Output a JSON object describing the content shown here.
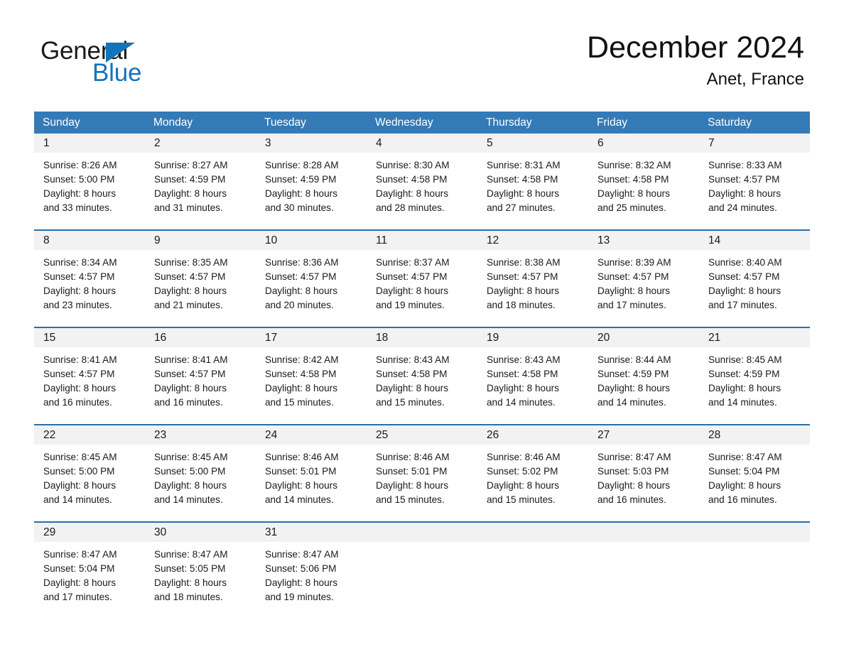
{
  "logo": {
    "word_one": "General",
    "word_two": "Blue",
    "flag_icon": "triangle-flag-icon",
    "accent_color": "#1373bc"
  },
  "header": {
    "title": "December 2024",
    "location": "Anet, France"
  },
  "theme": {
    "header_bg": "#337ab7",
    "row_border": "#2e6da4",
    "date_band_bg": "#f2f2f2",
    "text": "#1a1a1a"
  },
  "weekdays": [
    "Sunday",
    "Monday",
    "Tuesday",
    "Wednesday",
    "Thursday",
    "Friday",
    "Saturday"
  ],
  "weeks": [
    [
      {
        "date": "1",
        "sunrise": "Sunrise: 8:26 AM",
        "sunset": "Sunset: 5:00 PM",
        "daylight_line1": "Daylight: 8 hours",
        "daylight_line2": "and 33 minutes."
      },
      {
        "date": "2",
        "sunrise": "Sunrise: 8:27 AM",
        "sunset": "Sunset: 4:59 PM",
        "daylight_line1": "Daylight: 8 hours",
        "daylight_line2": "and 31 minutes."
      },
      {
        "date": "3",
        "sunrise": "Sunrise: 8:28 AM",
        "sunset": "Sunset: 4:59 PM",
        "daylight_line1": "Daylight: 8 hours",
        "daylight_line2": "and 30 minutes."
      },
      {
        "date": "4",
        "sunrise": "Sunrise: 8:30 AM",
        "sunset": "Sunset: 4:58 PM",
        "daylight_line1": "Daylight: 8 hours",
        "daylight_line2": "and 28 minutes."
      },
      {
        "date": "5",
        "sunrise": "Sunrise: 8:31 AM",
        "sunset": "Sunset: 4:58 PM",
        "daylight_line1": "Daylight: 8 hours",
        "daylight_line2": "and 27 minutes."
      },
      {
        "date": "6",
        "sunrise": "Sunrise: 8:32 AM",
        "sunset": "Sunset: 4:58 PM",
        "daylight_line1": "Daylight: 8 hours",
        "daylight_line2": "and 25 minutes."
      },
      {
        "date": "7",
        "sunrise": "Sunrise: 8:33 AM",
        "sunset": "Sunset: 4:57 PM",
        "daylight_line1": "Daylight: 8 hours",
        "daylight_line2": "and 24 minutes."
      }
    ],
    [
      {
        "date": "8",
        "sunrise": "Sunrise: 8:34 AM",
        "sunset": "Sunset: 4:57 PM",
        "daylight_line1": "Daylight: 8 hours",
        "daylight_line2": "and 23 minutes."
      },
      {
        "date": "9",
        "sunrise": "Sunrise: 8:35 AM",
        "sunset": "Sunset: 4:57 PM",
        "daylight_line1": "Daylight: 8 hours",
        "daylight_line2": "and 21 minutes."
      },
      {
        "date": "10",
        "sunrise": "Sunrise: 8:36 AM",
        "sunset": "Sunset: 4:57 PM",
        "daylight_line1": "Daylight: 8 hours",
        "daylight_line2": "and 20 minutes."
      },
      {
        "date": "11",
        "sunrise": "Sunrise: 8:37 AM",
        "sunset": "Sunset: 4:57 PM",
        "daylight_line1": "Daylight: 8 hours",
        "daylight_line2": "and 19 minutes."
      },
      {
        "date": "12",
        "sunrise": "Sunrise: 8:38 AM",
        "sunset": "Sunset: 4:57 PM",
        "daylight_line1": "Daylight: 8 hours",
        "daylight_line2": "and 18 minutes."
      },
      {
        "date": "13",
        "sunrise": "Sunrise: 8:39 AM",
        "sunset": "Sunset: 4:57 PM",
        "daylight_line1": "Daylight: 8 hours",
        "daylight_line2": "and 17 minutes."
      },
      {
        "date": "14",
        "sunrise": "Sunrise: 8:40 AM",
        "sunset": "Sunset: 4:57 PM",
        "daylight_line1": "Daylight: 8 hours",
        "daylight_line2": "and 17 minutes."
      }
    ],
    [
      {
        "date": "15",
        "sunrise": "Sunrise: 8:41 AM",
        "sunset": "Sunset: 4:57 PM",
        "daylight_line1": "Daylight: 8 hours",
        "daylight_line2": "and 16 minutes."
      },
      {
        "date": "16",
        "sunrise": "Sunrise: 8:41 AM",
        "sunset": "Sunset: 4:57 PM",
        "daylight_line1": "Daylight: 8 hours",
        "daylight_line2": "and 16 minutes."
      },
      {
        "date": "17",
        "sunrise": "Sunrise: 8:42 AM",
        "sunset": "Sunset: 4:58 PM",
        "daylight_line1": "Daylight: 8 hours",
        "daylight_line2": "and 15 minutes."
      },
      {
        "date": "18",
        "sunrise": "Sunrise: 8:43 AM",
        "sunset": "Sunset: 4:58 PM",
        "daylight_line1": "Daylight: 8 hours",
        "daylight_line2": "and 15 minutes."
      },
      {
        "date": "19",
        "sunrise": "Sunrise: 8:43 AM",
        "sunset": "Sunset: 4:58 PM",
        "daylight_line1": "Daylight: 8 hours",
        "daylight_line2": "and 14 minutes."
      },
      {
        "date": "20",
        "sunrise": "Sunrise: 8:44 AM",
        "sunset": "Sunset: 4:59 PM",
        "daylight_line1": "Daylight: 8 hours",
        "daylight_line2": "and 14 minutes."
      },
      {
        "date": "21",
        "sunrise": "Sunrise: 8:45 AM",
        "sunset": "Sunset: 4:59 PM",
        "daylight_line1": "Daylight: 8 hours",
        "daylight_line2": "and 14 minutes."
      }
    ],
    [
      {
        "date": "22",
        "sunrise": "Sunrise: 8:45 AM",
        "sunset": "Sunset: 5:00 PM",
        "daylight_line1": "Daylight: 8 hours",
        "daylight_line2": "and 14 minutes."
      },
      {
        "date": "23",
        "sunrise": "Sunrise: 8:45 AM",
        "sunset": "Sunset: 5:00 PM",
        "daylight_line1": "Daylight: 8 hours",
        "daylight_line2": "and 14 minutes."
      },
      {
        "date": "24",
        "sunrise": "Sunrise: 8:46 AM",
        "sunset": "Sunset: 5:01 PM",
        "daylight_line1": "Daylight: 8 hours",
        "daylight_line2": "and 14 minutes."
      },
      {
        "date": "25",
        "sunrise": "Sunrise: 8:46 AM",
        "sunset": "Sunset: 5:01 PM",
        "daylight_line1": "Daylight: 8 hours",
        "daylight_line2": "and 15 minutes."
      },
      {
        "date": "26",
        "sunrise": "Sunrise: 8:46 AM",
        "sunset": "Sunset: 5:02 PM",
        "daylight_line1": "Daylight: 8 hours",
        "daylight_line2": "and 15 minutes."
      },
      {
        "date": "27",
        "sunrise": "Sunrise: 8:47 AM",
        "sunset": "Sunset: 5:03 PM",
        "daylight_line1": "Daylight: 8 hours",
        "daylight_line2": "and 16 minutes."
      },
      {
        "date": "28",
        "sunrise": "Sunrise: 8:47 AM",
        "sunset": "Sunset: 5:04 PM",
        "daylight_line1": "Daylight: 8 hours",
        "daylight_line2": "and 16 minutes."
      }
    ],
    [
      {
        "date": "29",
        "sunrise": "Sunrise: 8:47 AM",
        "sunset": "Sunset: 5:04 PM",
        "daylight_line1": "Daylight: 8 hours",
        "daylight_line2": "and 17 minutes."
      },
      {
        "date": "30",
        "sunrise": "Sunrise: 8:47 AM",
        "sunset": "Sunset: 5:05 PM",
        "daylight_line1": "Daylight: 8 hours",
        "daylight_line2": "and 18 minutes."
      },
      {
        "date": "31",
        "sunrise": "Sunrise: 8:47 AM",
        "sunset": "Sunset: 5:06 PM",
        "daylight_line1": "Daylight: 8 hours",
        "daylight_line2": "and 19 minutes."
      },
      {
        "date": "",
        "sunrise": "",
        "sunset": "",
        "daylight_line1": "",
        "daylight_line2": ""
      },
      {
        "date": "",
        "sunrise": "",
        "sunset": "",
        "daylight_line1": "",
        "daylight_line2": ""
      },
      {
        "date": "",
        "sunrise": "",
        "sunset": "",
        "daylight_line1": "",
        "daylight_line2": ""
      },
      {
        "date": "",
        "sunrise": "",
        "sunset": "",
        "daylight_line1": "",
        "daylight_line2": ""
      }
    ]
  ]
}
